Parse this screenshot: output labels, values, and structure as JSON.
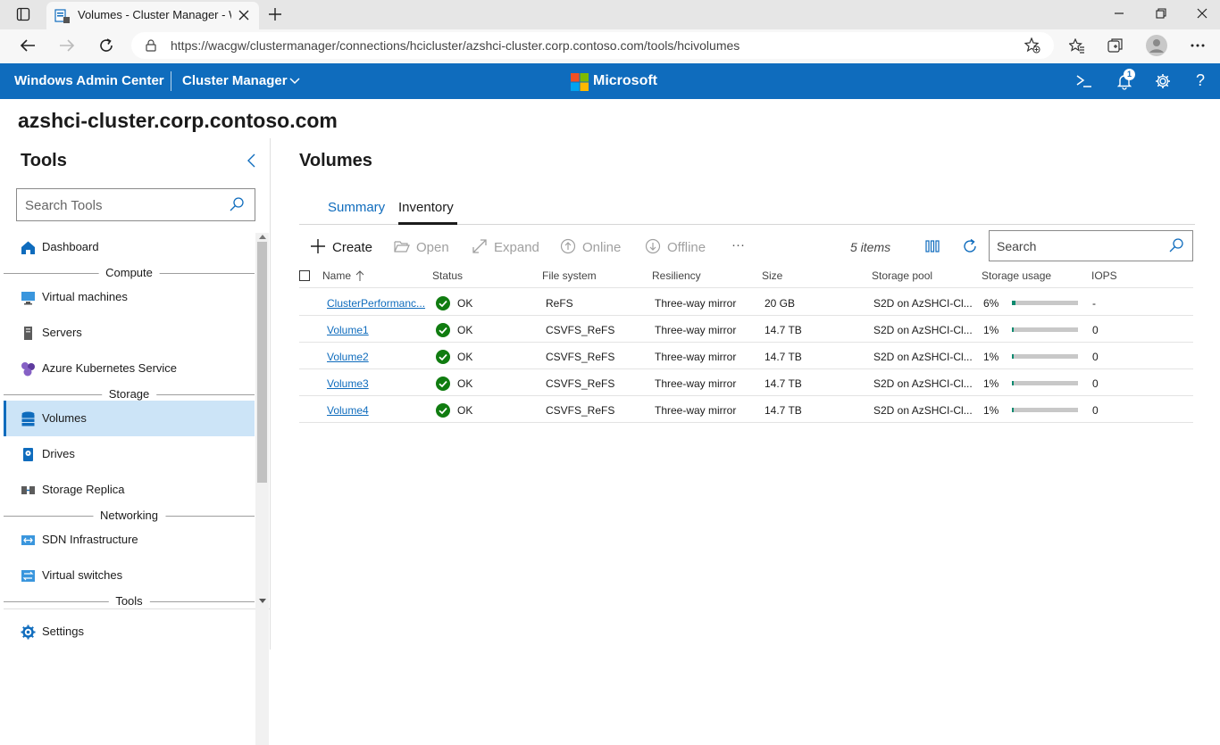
{
  "browser": {
    "tab_title": "Volumes - Cluster Manager - Wi",
    "url": "https://wacgw/clustermanager/connections/hcicluster/azshci-cluster.corp.contoso.com/tools/hcivolumes"
  },
  "header": {
    "app_name": "Windows Admin Center",
    "context": "Cluster Manager",
    "brand": "Microsoft",
    "notification_count": "1"
  },
  "cluster_name": "azshci-cluster.corp.contoso.com",
  "sidebar": {
    "title": "Tools",
    "search_placeholder": "Search Tools",
    "items": {
      "dashboard": "Dashboard",
      "section_compute": "Compute",
      "virtual_machines": "Virtual machines",
      "servers": "Servers",
      "aks": "Azure Kubernetes Service",
      "section_storage": "Storage",
      "volumes": "Volumes",
      "drives": "Drives",
      "storage_replica": "Storage Replica",
      "section_networking": "Networking",
      "sdn": "SDN Infrastructure",
      "virtual_switches": "Virtual switches",
      "section_tools": "Tools",
      "settings": "Settings"
    }
  },
  "main": {
    "title": "Volumes",
    "tabs": [
      "Summary",
      "Inventory"
    ],
    "active_tab": "Inventory",
    "toolbar": {
      "create": "Create",
      "open": "Open",
      "expand": "Expand",
      "online": "Online",
      "offline": "Offline",
      "more": "···",
      "item_count": "5 items",
      "search_placeholder": "Search"
    },
    "columns": [
      "Name",
      "Status",
      "File system",
      "Resiliency",
      "Size",
      "Storage pool",
      "Storage usage",
      "IOPS"
    ],
    "rows": [
      {
        "name": "ClusterPerformanc...",
        "status": "OK",
        "fs": "ReFS",
        "resiliency": "Three-way mirror",
        "size": "20 GB",
        "pool": "S2D on AzSHCI-Cl...",
        "usage": "6%",
        "usage_fraction": 0.06,
        "iops": "-"
      },
      {
        "name": "Volume1",
        "status": "OK",
        "fs": "CSVFS_ReFS",
        "resiliency": "Three-way mirror",
        "size": "14.7 TB",
        "pool": "S2D on AzSHCI-Cl...",
        "usage": "1%",
        "usage_fraction": 0.01,
        "iops": "0"
      },
      {
        "name": "Volume2",
        "status": "OK",
        "fs": "CSVFS_ReFS",
        "resiliency": "Three-way mirror",
        "size": "14.7 TB",
        "pool": "S2D on AzSHCI-Cl...",
        "usage": "1%",
        "usage_fraction": 0.01,
        "iops": "0"
      },
      {
        "name": "Volume3",
        "status": "OK",
        "fs": "CSVFS_ReFS",
        "resiliency": "Three-way mirror",
        "size": "14.7 TB",
        "pool": "S2D on AzSHCI-Cl...",
        "usage": "1%",
        "usage_fraction": 0.01,
        "iops": "0"
      },
      {
        "name": "Volume4",
        "status": "OK",
        "fs": "CSVFS_ReFS",
        "resiliency": "Three-way mirror",
        "size": "14.7 TB",
        "pool": "S2D on AzSHCI-Cl...",
        "usage": "1%",
        "usage_fraction": 0.01,
        "iops": "0"
      }
    ]
  },
  "colors": {
    "accent": "#0f6cbd",
    "ok_green": "#107c10",
    "usage_fill": "#0d8a6f"
  }
}
